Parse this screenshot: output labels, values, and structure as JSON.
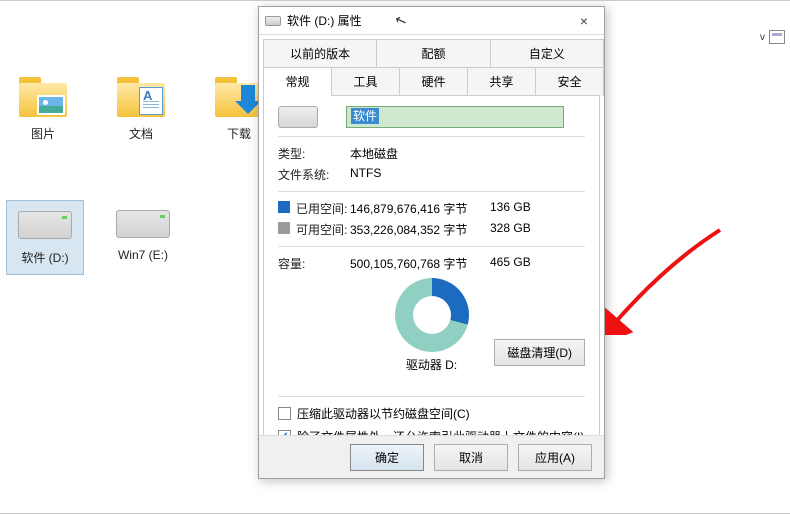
{
  "toolbar": {
    "view_chevron": "v"
  },
  "folders": [
    {
      "label": "图片"
    },
    {
      "label": "文档"
    },
    {
      "label": "下载"
    }
  ],
  "drives": [
    {
      "label": "软件 (D:)",
      "selected": true
    },
    {
      "label": "Win7 (E:)",
      "selected": false
    }
  ],
  "dialog": {
    "title": "软件 (D:) 属性",
    "tabs_row_top": [
      "以前的版本",
      "配额",
      "自定义"
    ],
    "tabs_row_bottom": [
      "常规",
      "工具",
      "硬件",
      "共享",
      "安全"
    ],
    "active_tab": "常规",
    "name_value": "软件",
    "type_label": "类型:",
    "type_value": "本地磁盘",
    "filesystem_label": "文件系统:",
    "filesystem_value": "NTFS",
    "used_label": "已用空间:",
    "used_bytes": "146,879,676,416 字节",
    "used_human": "136 GB",
    "free_label": "可用空间:",
    "free_bytes": "353,226,084,352 字节",
    "free_human": "328 GB",
    "capacity_label": "容量:",
    "capacity_bytes": "500,105,760,768 字节",
    "capacity_human": "465 GB",
    "drive_caption": "驱动器 D:",
    "cleanup_button": "磁盘清理(D)",
    "compress_label": "压缩此驱动器以节约磁盘空间(C)",
    "index_label": "除了文件属性外，还允许索引此驱动器上文件的内容(I)",
    "compress_checked": false,
    "index_checked": true,
    "ok_button": "确定",
    "cancel_button": "取消",
    "apply_button": "应用(A)"
  },
  "chart_data": {
    "type": "pie",
    "title": "驱动器 D:",
    "series": [
      {
        "name": "已用空间",
        "value": 136,
        "unit": "GB",
        "color": "#1b6bc0"
      },
      {
        "name": "可用空间",
        "value": 328,
        "unit": "GB",
        "color": "#8fd0c2"
      }
    ],
    "total": {
      "name": "容量",
      "value": 465,
      "unit": "GB"
    }
  }
}
